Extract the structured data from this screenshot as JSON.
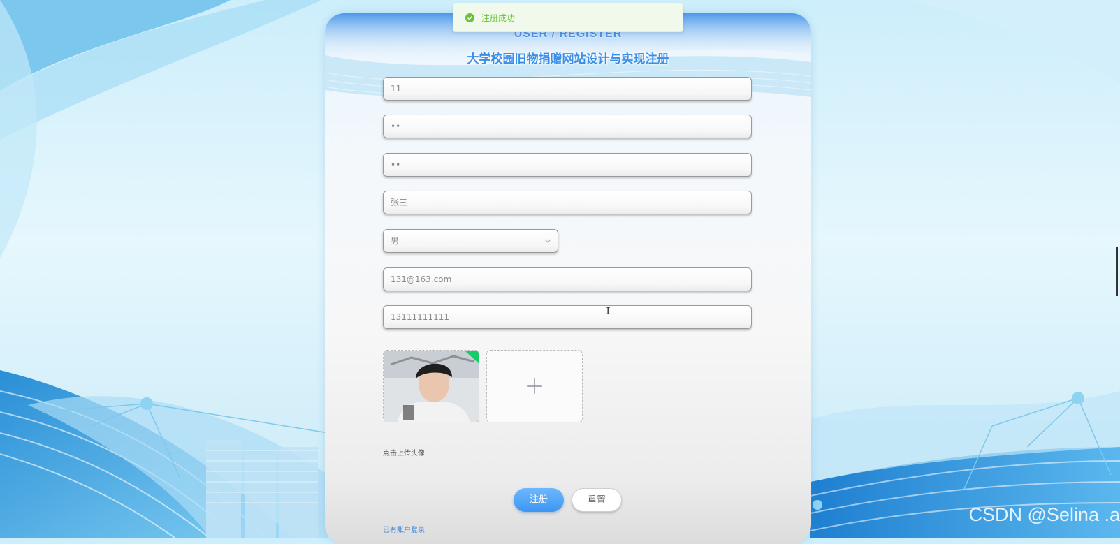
{
  "colors": {
    "accent": "#3d95f2",
    "success": "#67c23a",
    "title": "#3a8ee8"
  },
  "toast": {
    "icon": "check-circle-icon",
    "text": "注册成功"
  },
  "header": {
    "title_en": "USER / REGISTER",
    "title_cn": "大学校园旧物捐赠网站设计与实现注册"
  },
  "form": {
    "account": "11",
    "password": "••",
    "confirm_password": "••",
    "name": "张三",
    "gender": "男",
    "email": "131@163.com",
    "phone": "13111111111"
  },
  "upload": {
    "label": "点击上传头像",
    "add_icon": "plus-icon"
  },
  "buttons": {
    "register": "注册",
    "reset": "重置"
  },
  "links": {
    "login": "已有账户登录"
  },
  "watermark": "CSDN @Selina .a"
}
